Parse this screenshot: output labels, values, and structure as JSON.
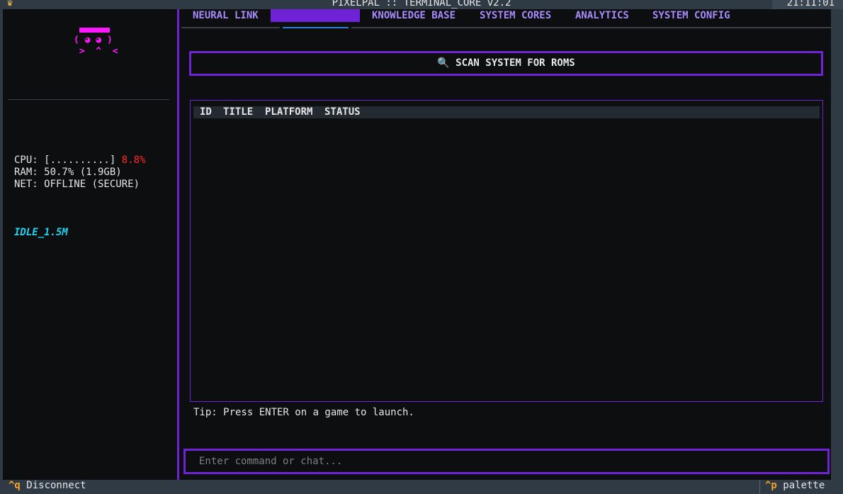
{
  "header": {
    "title": "PIXELPAL :: TERMINAL_CORE v2.2",
    "clock": "21:11:01"
  },
  "sidebar": {
    "mascot": {
      "line1": "( ◕ ◕ )",
      "line2": " >  ^  <"
    },
    "stats": {
      "cpu_label": "CPU: [..........] ",
      "cpu_value": "8.8%",
      "ram": "RAM: 50.7% (1.9GB)",
      "net": "NET: OFFLINE (SECURE)"
    },
    "idle_status": "IDLE_1.5M"
  },
  "tabs": [
    {
      "label": "NEURAL LINK"
    },
    {
      "label": ""
    },
    {
      "label": "KNOWLEDGE BASE"
    },
    {
      "label": "SYSTEM CORES"
    },
    {
      "label": "ANALYTICS"
    },
    {
      "label": "SYSTEM CONFIG"
    }
  ],
  "main": {
    "scan_button": "🔍 SCAN SYSTEM FOR ROMS",
    "table": {
      "columns": [
        "ID",
        "TITLE",
        "PLATFORM",
        "STATUS"
      ],
      "rows": []
    },
    "tip": "Tip: Press ENTER on a game to launch."
  },
  "command": {
    "placeholder": "Enter command or chat...",
    "value": ""
  },
  "footer": {
    "quit_key": "^q",
    "quit_label": " Disconnect",
    "palette_key": "^p",
    "palette_label": " palette"
  },
  "colors": {
    "accent": "#6f22d6",
    "mascot": "#ff17ff",
    "warning": "#ff2a2a",
    "idle": "#22d3ee",
    "hotkey": "#f5a524"
  }
}
